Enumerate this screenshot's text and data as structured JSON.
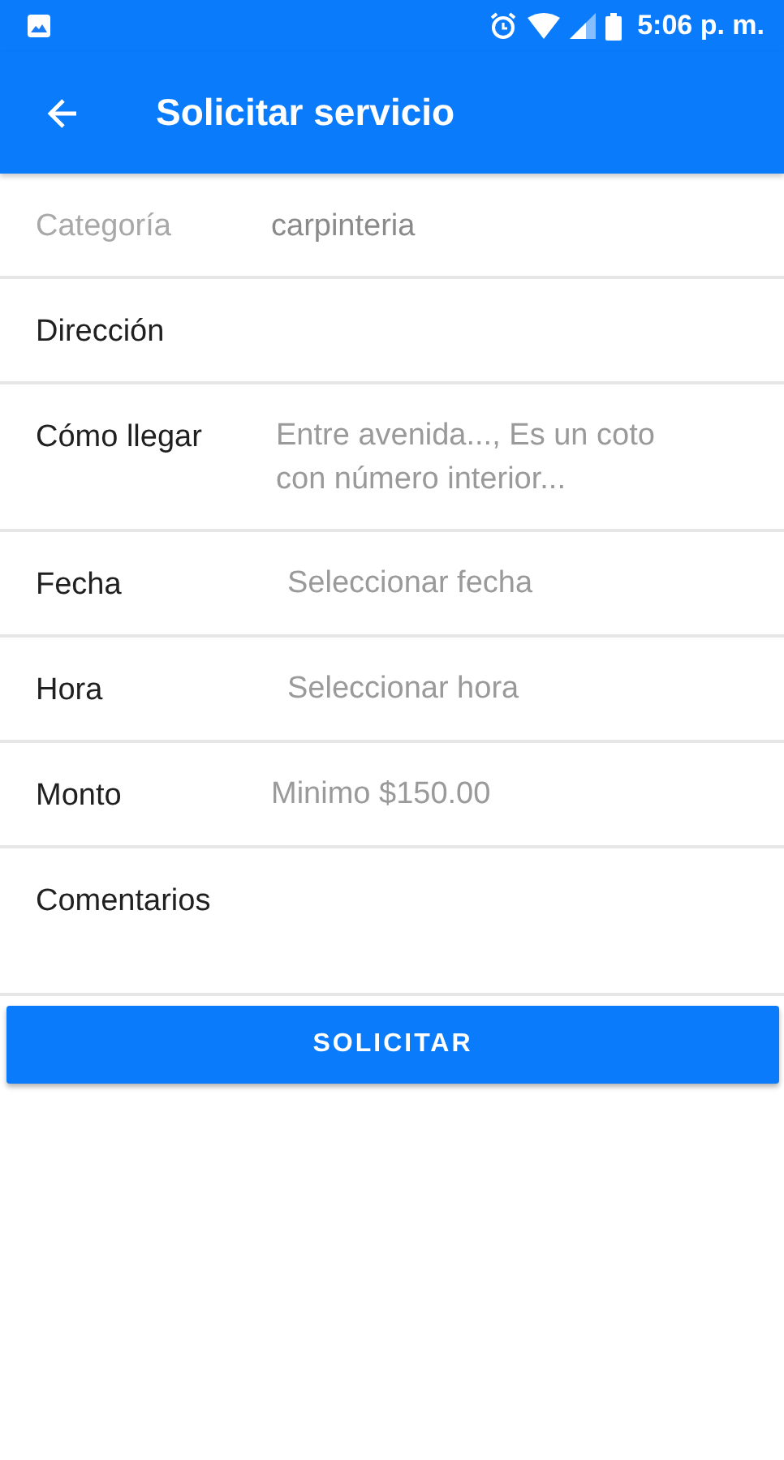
{
  "status_bar": {
    "time": "5:06 p. m."
  },
  "app_bar": {
    "title": "Solicitar servicio"
  },
  "form": {
    "rows": [
      {
        "label": "Categoría",
        "value": "carpinteria",
        "disabled": true,
        "kind": "single"
      },
      {
        "label": "Dirección",
        "disabled": false,
        "kind": "single"
      },
      {
        "label": "Cómo llegar",
        "placeholder": "Entre avenida..., Es un coto con número interior...",
        "disabled": false,
        "kind": "multiline"
      },
      {
        "label": "Fecha",
        "placeholder": "Seleccionar fecha",
        "disabled": false,
        "kind": "picker"
      },
      {
        "label": "Hora",
        "placeholder": "Seleccionar hora",
        "disabled": false,
        "kind": "picker"
      },
      {
        "label": "Monto",
        "placeholder": "Minimo $150.00",
        "disabled": false,
        "kind": "single"
      },
      {
        "label": "Comentarios",
        "disabled": false,
        "kind": "multiline"
      }
    ]
  },
  "submit_button": {
    "label": "SOLICITAR"
  }
}
